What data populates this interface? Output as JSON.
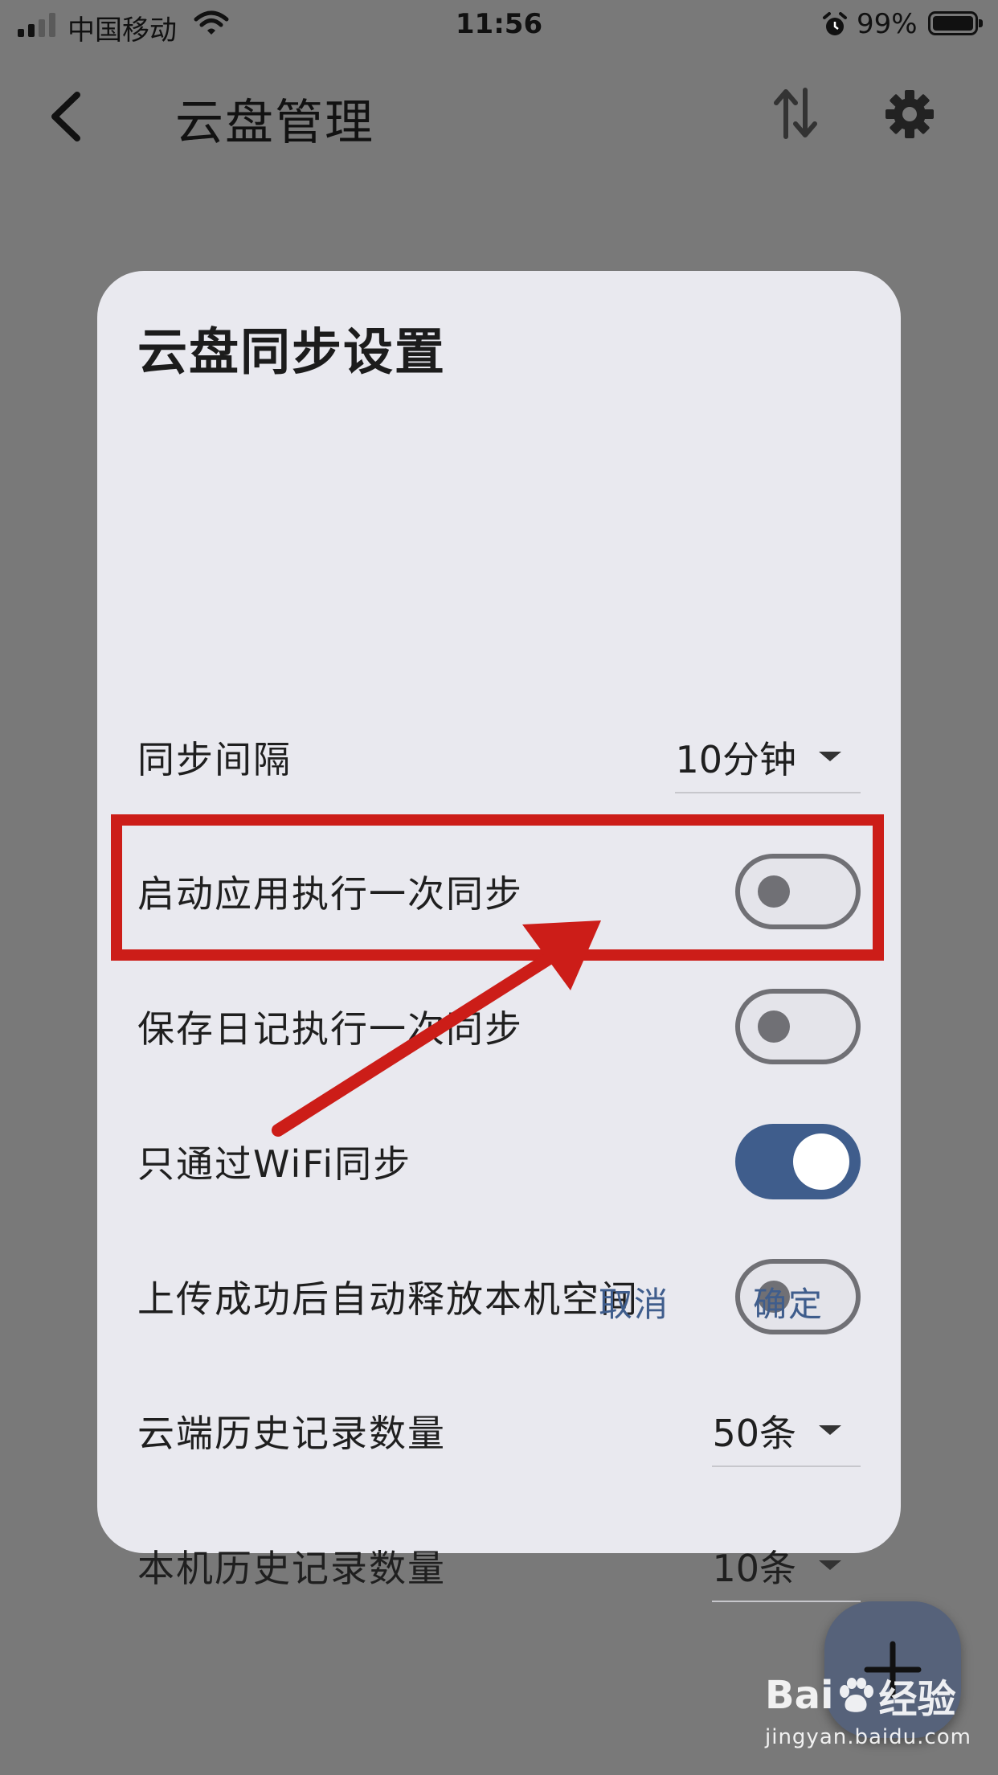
{
  "status_bar": {
    "carrier": "中国移动",
    "time": "11:56",
    "battery": "99%"
  },
  "app_bar": {
    "title": "云盘管理",
    "icons": [
      "back-icon",
      "sort-icon",
      "gear-icon"
    ]
  },
  "dialog": {
    "title": "云盘同步设置",
    "rows": [
      {
        "label": "同步间隔",
        "type": "select",
        "value": "10分钟"
      },
      {
        "label": "启动应用执行一次同步",
        "type": "toggle",
        "on": false
      },
      {
        "label": "保存日记执行一次同步",
        "type": "toggle",
        "on": false
      },
      {
        "label": "只通过WiFi同步",
        "type": "toggle",
        "on": true
      },
      {
        "label": "上传成功后自动释放本机空间",
        "type": "toggle",
        "on": false
      },
      {
        "label": "云端历史记录数量",
        "type": "select",
        "value": "50条"
      },
      {
        "label": "本机历史记录数量",
        "type": "select",
        "value": "10条"
      }
    ],
    "cancel_label": "取消",
    "ok_label": "确定"
  },
  "watermark": {
    "brand_left": "Bai",
    "brand_right": "经验",
    "url": "jingyan.baidu.com"
  },
  "colors": {
    "accent": "#3f5d8c",
    "annotation_red": "#cc1d18",
    "overlay": "#797979",
    "dialog_bg": "#e9e9ef"
  }
}
